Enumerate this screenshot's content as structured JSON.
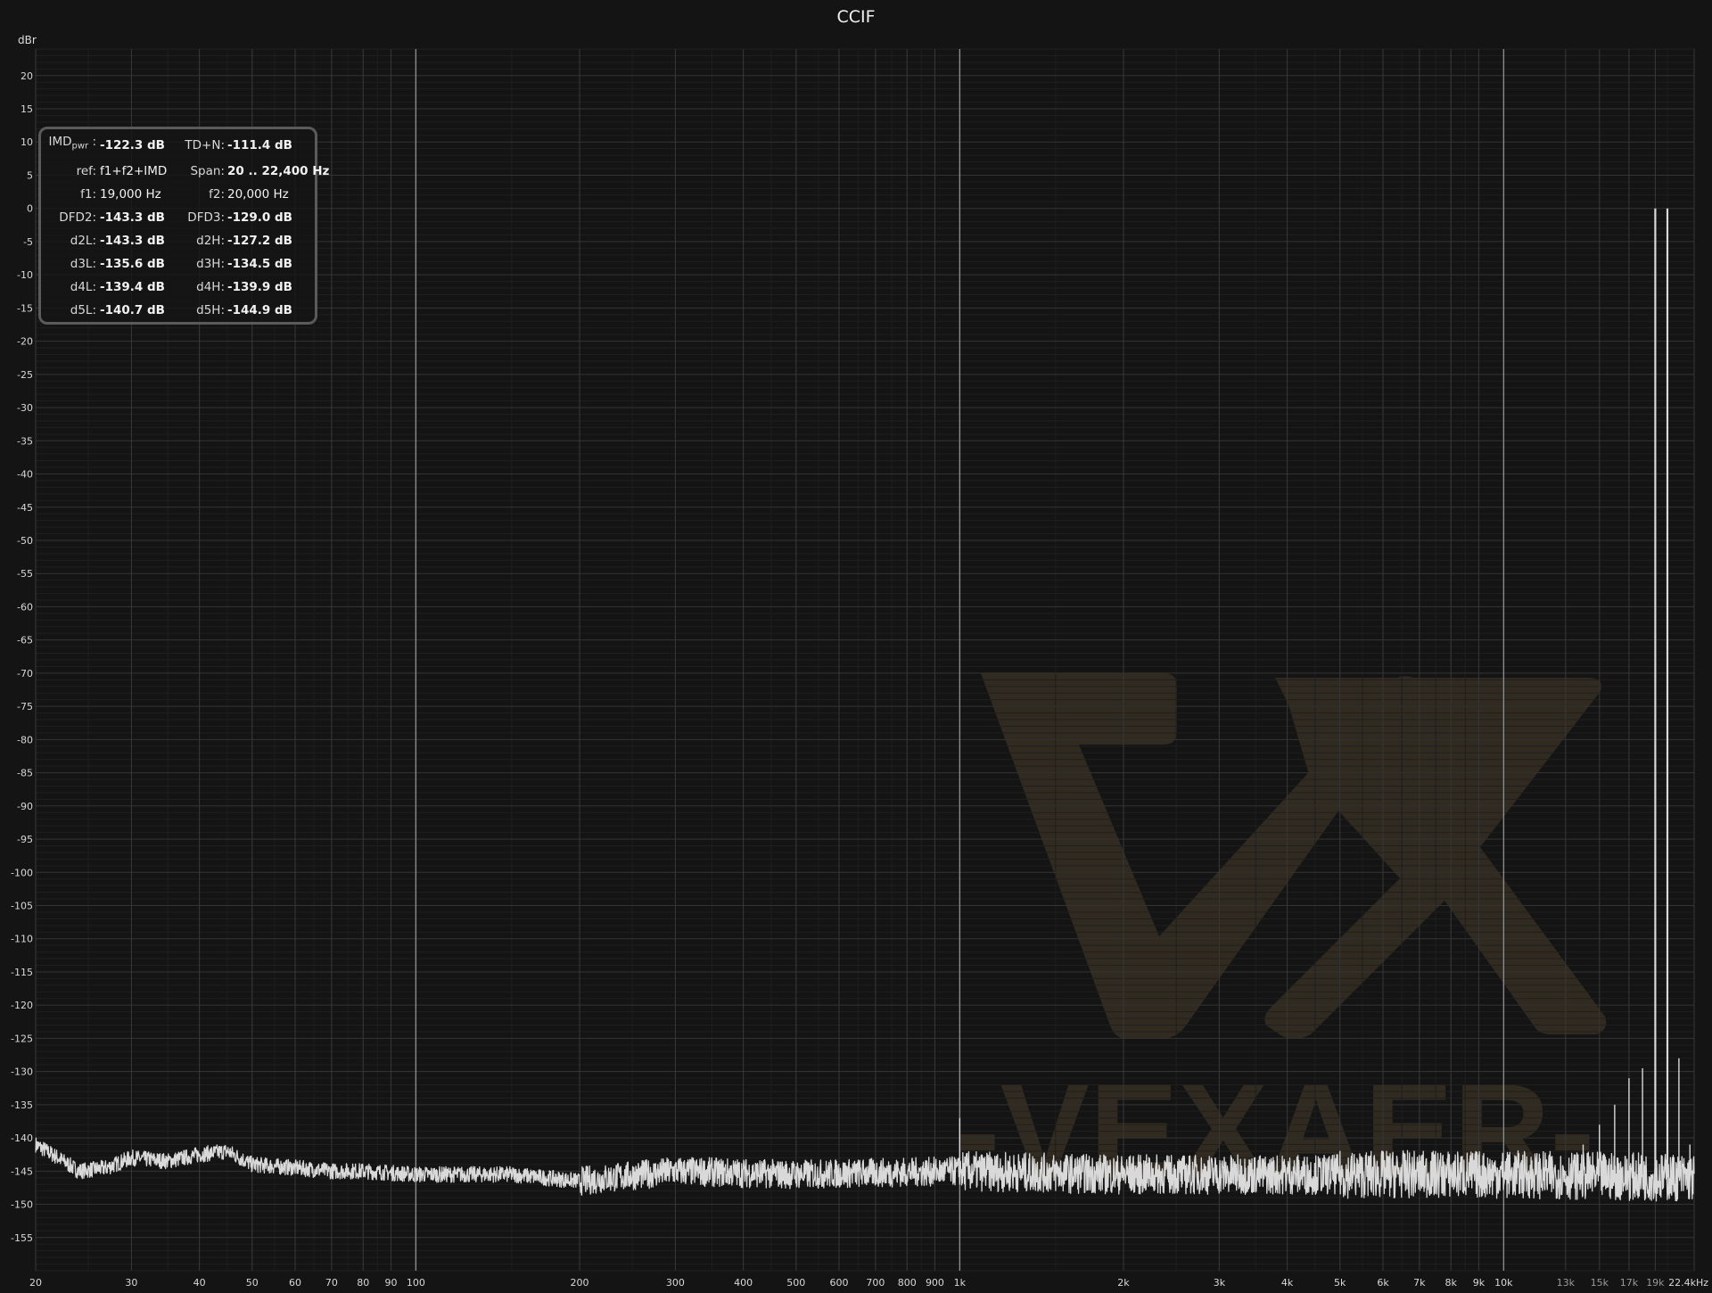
{
  "chart_data": {
    "type": "line",
    "title": "CCIF",
    "ylabel": "dBr",
    "xscale": "log",
    "xlim": [
      20,
      22400
    ],
    "ylim": [
      -160,
      24
    ],
    "grid": true,
    "y_ticks": [
      20,
      15,
      10,
      5,
      0,
      -5,
      -10,
      -15,
      -20,
      -25,
      -30,
      -35,
      -40,
      -45,
      -50,
      -55,
      -60,
      -65,
      -70,
      -75,
      -80,
      -85,
      -90,
      -95,
      -100,
      -105,
      -110,
      -115,
      -120,
      -125,
      -130,
      -135,
      -140,
      -145,
      -150,
      -155
    ],
    "x_ticks": [
      {
        "value": 20,
        "label": "20"
      },
      {
        "value": 30,
        "label": "30"
      },
      {
        "value": 40,
        "label": "40"
      },
      {
        "value": 50,
        "label": "50"
      },
      {
        "value": 60,
        "label": "60"
      },
      {
        "value": 70,
        "label": "70"
      },
      {
        "value": 80,
        "label": "80"
      },
      {
        "value": 90,
        "label": "90"
      },
      {
        "value": 100,
        "label": "100"
      },
      {
        "value": 200,
        "label": "200"
      },
      {
        "value": 300,
        "label": "300"
      },
      {
        "value": 400,
        "label": "400"
      },
      {
        "value": 500,
        "label": "500"
      },
      {
        "value": 600,
        "label": "600"
      },
      {
        "value": 700,
        "label": "700"
      },
      {
        "value": 800,
        "label": "800"
      },
      {
        "value": 900,
        "label": "900"
      },
      {
        "value": 1000,
        "label": "1k"
      },
      {
        "value": 2000,
        "label": "2k"
      },
      {
        "value": 3000,
        "label": "3k"
      },
      {
        "value": 4000,
        "label": "4k"
      },
      {
        "value": 5000,
        "label": "5k"
      },
      {
        "value": 6000,
        "label": "6k"
      },
      {
        "value": 7000,
        "label": "7k"
      },
      {
        "value": 8000,
        "label": "8k"
      },
      {
        "value": 9000,
        "label": "9k"
      },
      {
        "value": 10000,
        "label": "10k"
      },
      {
        "value": 13000,
        "label": "13k"
      },
      {
        "value": 15000,
        "label": "15k"
      },
      {
        "value": 17000,
        "label": "17k"
      },
      {
        "value": 19000,
        "label": "19k"
      },
      {
        "value": 22400,
        "label": "22.4kHz"
      }
    ],
    "series": [
      {
        "color": "#d9d9d9",
        "noise_floor": [
          [
            20,
            -141
          ],
          [
            22,
            -143
          ],
          [
            24,
            -145
          ],
          [
            27,
            -144.5
          ],
          [
            30,
            -143
          ],
          [
            35,
            -143.5
          ],
          [
            40,
            -142.5
          ],
          [
            45,
            -142
          ],
          [
            50,
            -144
          ],
          [
            60,
            -144.5
          ],
          [
            70,
            -145
          ],
          [
            80,
            -145
          ],
          [
            100,
            -145.5
          ],
          [
            150,
            -145.5
          ],
          [
            200,
            -146.5
          ],
          [
            300,
            -145
          ],
          [
            500,
            -145.5
          ],
          [
            1000,
            -145
          ],
          [
            2000,
            -145.5
          ],
          [
            5000,
            -145.5
          ],
          [
            10000,
            -145.5
          ],
          [
            22400,
            -146
          ]
        ],
        "peaks": [
          [
            1000,
            -137
          ],
          [
            13000,
            -145
          ],
          [
            14000,
            -141
          ],
          [
            15000,
            -138
          ],
          [
            16000,
            -135
          ],
          [
            17000,
            -131
          ],
          [
            18000,
            -129.5
          ],
          [
            19000,
            0
          ],
          [
            20000,
            0
          ],
          [
            21000,
            -128
          ],
          [
            22000,
            -141
          ]
        ]
      }
    ]
  },
  "stats": [
    {
      "label": "IMD",
      "label_sub": "pwr",
      "label_suffix": ":",
      "value": "-122.3 dB",
      "label2": "TD+N:",
      "value2": "-111.4 dB"
    },
    {
      "label": "ref:",
      "value": "f1+f2+IMD",
      "label2": "Span:",
      "value2": "20 .. 22,400 Hz"
    },
    {
      "label": "f1:",
      "value": "19,000 Hz",
      "label2": "f2:",
      "value2": "20,000 Hz"
    },
    {
      "label": "DFD2:",
      "value": "-143.3 dB",
      "label2": "DFD3:",
      "value2": "-129.0 dB"
    },
    {
      "label": "d2L:",
      "value": "-143.3 dB",
      "label2": "d2H:",
      "value2": "-127.2 dB"
    },
    {
      "label": "d3L:",
      "value": "-135.6 dB",
      "label2": "d3H:",
      "value2": "-134.5 dB"
    },
    {
      "label": "d4L:",
      "value": "-139.4 dB",
      "label2": "d4H:",
      "value2": "-139.9 dB"
    },
    {
      "label": "d5L:",
      "value": "-140.7 dB",
      "label2": "d5H:",
      "value2": "-144.9 dB"
    }
  ],
  "watermark": {
    "text": "-VEXAER-",
    "color": "#6a5638"
  }
}
